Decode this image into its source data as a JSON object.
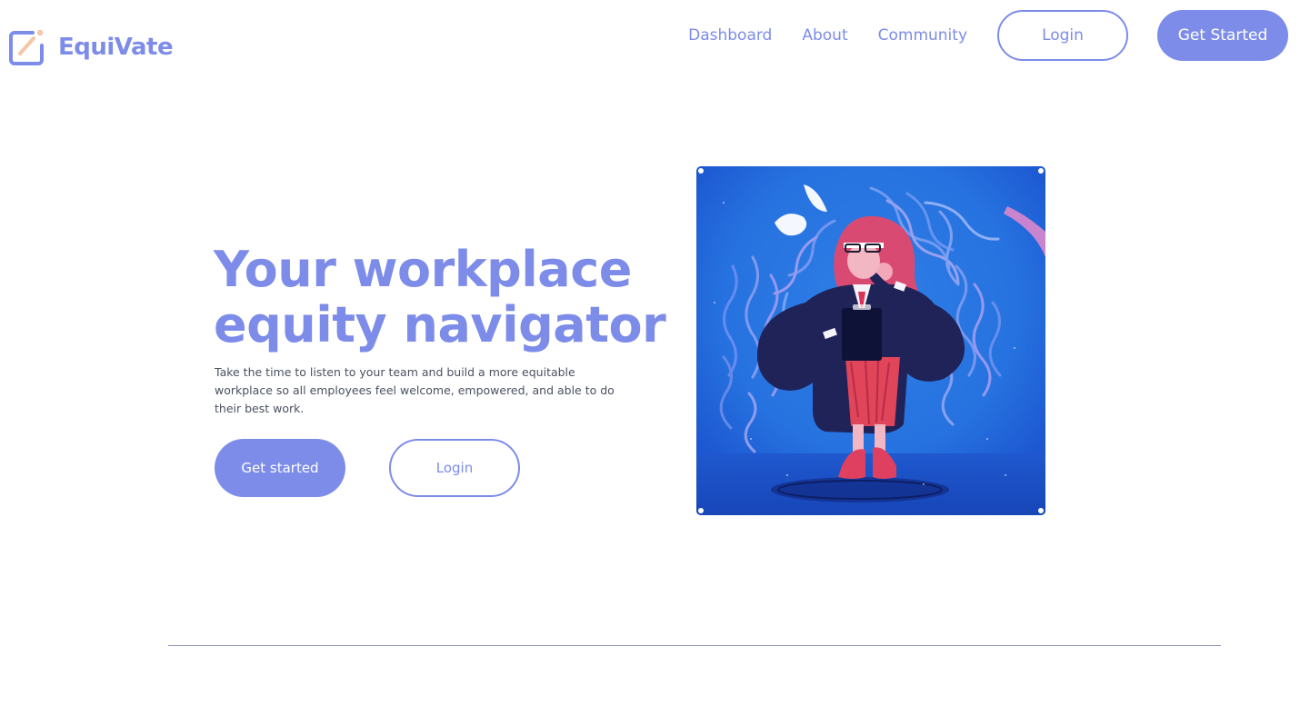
{
  "brand": {
    "name": "EquiVate",
    "logo_icon": "pencil-square-icon",
    "accent_color": "#7d8ce8"
  },
  "nav": {
    "links": [
      "Dashboard",
      "About",
      "Community"
    ],
    "login_label": "Login",
    "get_started_label": "Get Started"
  },
  "hero": {
    "title_line1": "Your workplace",
    "title_line2": "equity navigator",
    "description": "Take the time to listen to your team and build a more equitable workplace so all employees feel welcome, empowered, and able to do their best work.",
    "get_started_label": "Get started",
    "login_label": "Login",
    "illustration": "woman-with-clipboard-illustration"
  }
}
